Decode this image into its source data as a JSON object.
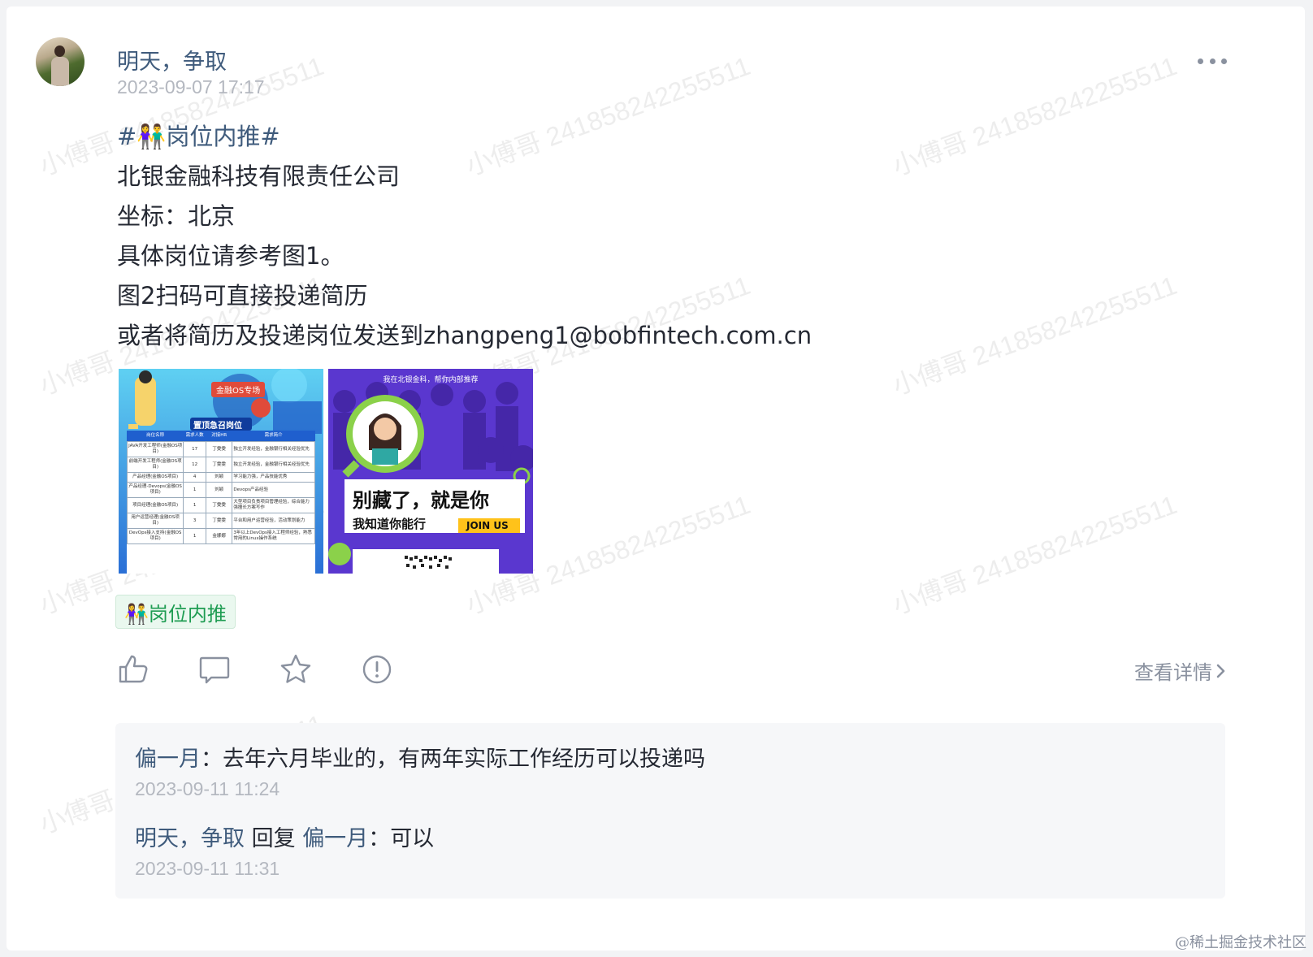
{
  "post": {
    "author": "明天，争取",
    "time": "2023-09-07 17:17",
    "hashtag": "#👫岗位内推#",
    "lines": [
      "北银金融科技有限责任公司",
      "坐标：北京",
      "具体岗位请参考图1。",
      "图2扫码可直接投递简历",
      "或者将简历及投递岗位发送到zhangpeng1@bobfintech.com.cn"
    ],
    "tag": "👫岗位内推",
    "detail_label": "查看详情"
  },
  "image1": {
    "badge": "金融OS专场",
    "banner": "置顶急召岗位",
    "headers": [
      "岗位名称",
      "需求人数",
      "对接HR",
      "需求简介"
    ],
    "rows": [
      [
        "JAVA开发工程师(金融OS项目)",
        "17",
        "丁雯雯",
        "独立开发经验，金融银行相关经验优先"
      ],
      [
        "前端开发工程师(金融OS项目)",
        "12",
        "丁雯雯",
        "独立开发经验，金融银行相关经验优先"
      ],
      [
        "产品经理(金融OS项目)",
        "4",
        "刘颖",
        "学习能力强，产品技能优秀"
      ],
      [
        "产品经理-Devops(金融OS项目)",
        "1",
        "刘颖",
        "Devops产品经验"
      ],
      [
        "项目经理(金融OS项目)",
        "1",
        "丁雯雯",
        "大型项目负责项目管理经验，综合能力强擅长方案写作"
      ],
      [
        "用户运营经理(金融OS项目)",
        "3",
        "丁雯雯",
        "平台和用户运营经验，活动策划能力"
      ],
      [
        "DevOps接入支持(金融OS项目)",
        "1",
        "金娜娜",
        "3年以上DevOps接入工程师经验，熟悉常用的Linux操作系统"
      ]
    ]
  },
  "image2": {
    "top_text": "我在北银金科，帮你内部推荐",
    "headline": "别藏了，就是你",
    "subline": "我知道你能行",
    "join": "JOIN US"
  },
  "comments": [
    {
      "name": "偏一月",
      "sep": "：",
      "text": "去年六月毕业的，有两年实际工作经历可以投递吗",
      "time": "2023-09-11 11:24"
    },
    {
      "name": "明天，争取",
      "reply_word": "回复",
      "target": "偏一月",
      "sep": "：",
      "text": "可以",
      "time": "2023-09-11 11:31"
    }
  ],
  "watermark": {
    "text": "小傅哥 241858242255511",
    "footer": "@稀土掘金技术社区"
  },
  "colors": {
    "link": "#3f5b7c",
    "tag_green": "#1e9c52",
    "muted": "#b4b8c0",
    "panel": "#f6f7f9"
  }
}
